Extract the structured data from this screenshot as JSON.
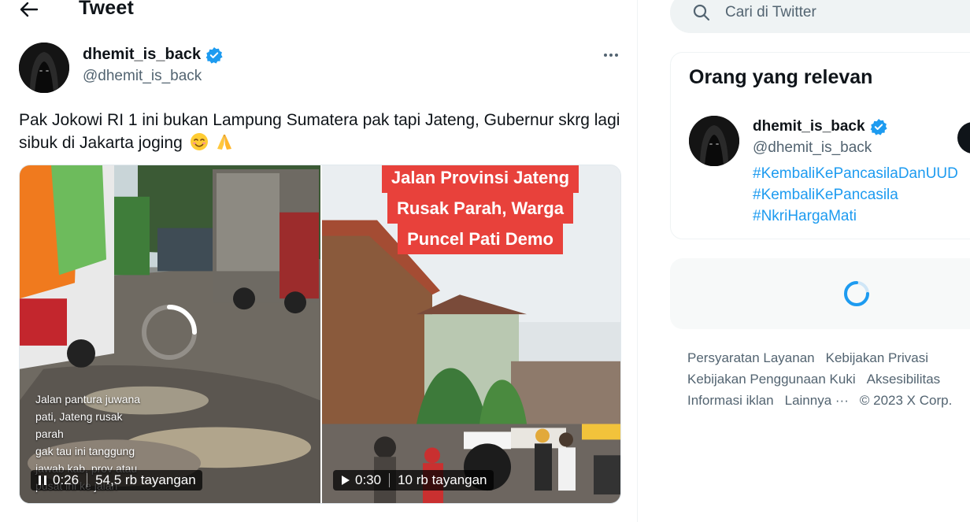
{
  "header": {
    "title": "Tweet"
  },
  "tweet": {
    "author_name": "dhemit_is_back",
    "author_handle": "@dhemit_is_back",
    "text": "Pak Jokowi RI 1 ini bukan Lampung Sumatera pak tapi Jateng, Gubernur skrg lagi sibuk di Jakarta joging",
    "emojis": [
      "smiling-face-icon",
      "folded-hands-icon"
    ],
    "videos": [
      {
        "caption_lines": [
          "Jalan pantura juwana",
          "pati, Jateng rusak",
          "parah",
          "gak tau ini tanggung",
          "jawab kab, prov atau",
          "pusat ini ke jalan"
        ],
        "state": "pause-icon",
        "duration": "0:26",
        "views": "54,5 rb tayangan"
      },
      {
        "title_lines": [
          "Jalan Provinsi Jateng",
          "Rusak Parah, Warga",
          "Puncel Pati Demo"
        ],
        "state": "play-icon",
        "duration": "0:30",
        "views": "10 rb tayangan"
      }
    ]
  },
  "sidebar": {
    "search_placeholder": "Cari di Twitter",
    "relevant": {
      "title": "Orang yang relevan",
      "name": "dhemit_is_back",
      "handle": "@dhemit_is_back",
      "hashtags": [
        "#KembaliKePancasilaDanUUD",
        "#KembaliKePancasila",
        "#NkriHargaMati"
      ]
    },
    "footer": {
      "links": [
        "Persyaratan Layanan",
        "Kebijakan Privasi",
        "Kebijakan Penggunaan Kuki",
        "Aksesibilitas",
        "Informasi iklan",
        "Lainnya ···"
      ],
      "copyright": "© 2023 X Corp."
    }
  },
  "colors": {
    "accent": "#1d9bf0",
    "text": "#0f1419",
    "muted": "#536471",
    "video_title_bg": "#e8413b"
  }
}
